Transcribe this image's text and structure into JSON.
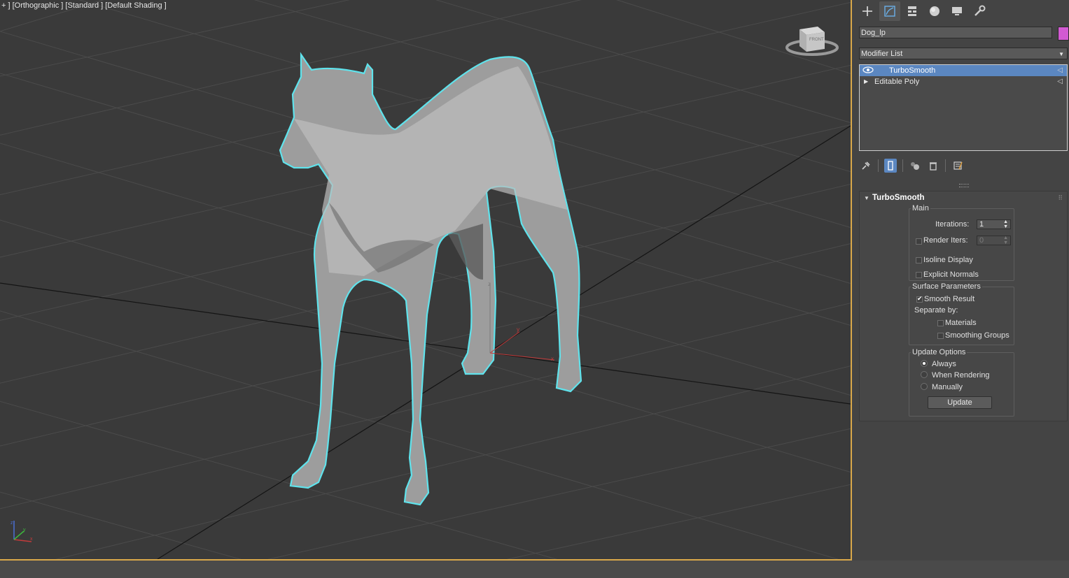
{
  "viewport": {
    "label": "+ ] [Orthographic ] [Standard ] [Default Shading ]",
    "viewcube_label": "FRONT",
    "selection_outline_color": "#5fe3ec",
    "axis_colors": {
      "x": "#c23b3b",
      "y": "#3dbb3d",
      "z": "#4a6fd6"
    }
  },
  "command_panel": {
    "tabs": [
      {
        "icon": "plus-icon",
        "name": "Create"
      },
      {
        "icon": "modify-icon",
        "name": "Modify",
        "active": true
      },
      {
        "icon": "hierarchy-icon",
        "name": "Hierarchy"
      },
      {
        "icon": "motion-icon",
        "name": "Motion"
      },
      {
        "icon": "display-icon",
        "name": "Display"
      },
      {
        "icon": "utilities-icon",
        "name": "Utilities"
      }
    ],
    "object_name": "Dog_lp",
    "object_color": "#d25ad2",
    "modifier_list": "Modifier List",
    "stack": [
      {
        "label": "TurboSmooth",
        "selected": true
      },
      {
        "label": "Editable Poly",
        "selected": false
      }
    ]
  },
  "turbosmooth": {
    "title": "TurboSmooth",
    "main": {
      "legend": "Main",
      "iterations_label": "Iterations:",
      "iterations_value": "1",
      "render_iters_label": "Render Iters:",
      "render_iters_value": "0",
      "isoline_label": "Isoline Display",
      "explicit_normals_label": "Explicit Normals"
    },
    "surface": {
      "legend": "Surface Parameters",
      "smooth_result_label": "Smooth Result",
      "separate_by_label": "Separate by:",
      "materials_label": "Materials",
      "smoothing_groups_label": "Smoothing Groups"
    },
    "update": {
      "legend": "Update Options",
      "always_label": "Always",
      "when_rendering_label": "When Rendering",
      "manually_label": "Manually",
      "update_button": "Update"
    }
  }
}
